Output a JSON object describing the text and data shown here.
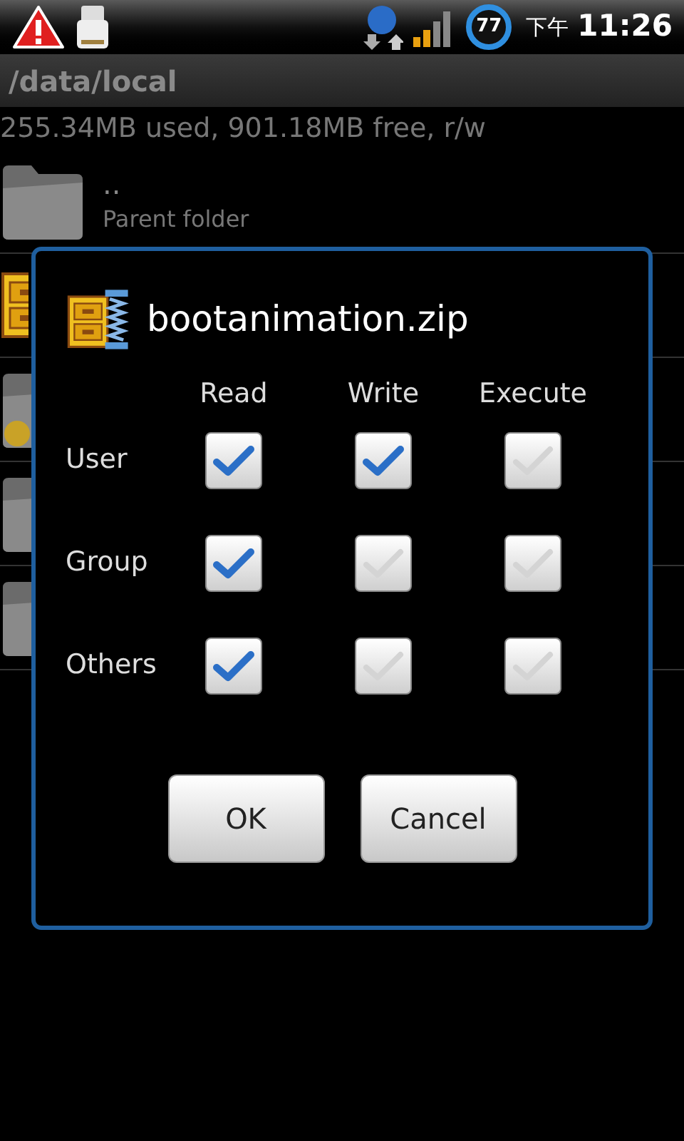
{
  "status_bar": {
    "battery": "77",
    "period": "下午",
    "time": "11:26"
  },
  "path": "/data/local",
  "storage": "255.34MB used, 901.18MB free, r/w",
  "files": [
    {
      "kind": "parent",
      "name": "..",
      "detail": "Parent folder"
    },
    {
      "kind": "zip"
    },
    {
      "kind": "badge-folder"
    },
    {
      "kind": "folder"
    },
    {
      "kind": "folder"
    }
  ],
  "dialog": {
    "title": "bootanimation.zip",
    "columns": [
      "Read",
      "Write",
      "Execute"
    ],
    "rows": [
      {
        "label": "User",
        "permissions": [
          {
            "checked": true
          },
          {
            "checked": true
          },
          {
            "checked": false
          }
        ]
      },
      {
        "label": "Group",
        "permissions": [
          {
            "checked": true
          },
          {
            "checked": false
          },
          {
            "checked": false
          }
        ]
      },
      {
        "label": "Others",
        "permissions": [
          {
            "checked": true
          },
          {
            "checked": false
          },
          {
            "checked": false
          }
        ]
      }
    ],
    "buttons": [
      "OK",
      "Cancel"
    ]
  }
}
